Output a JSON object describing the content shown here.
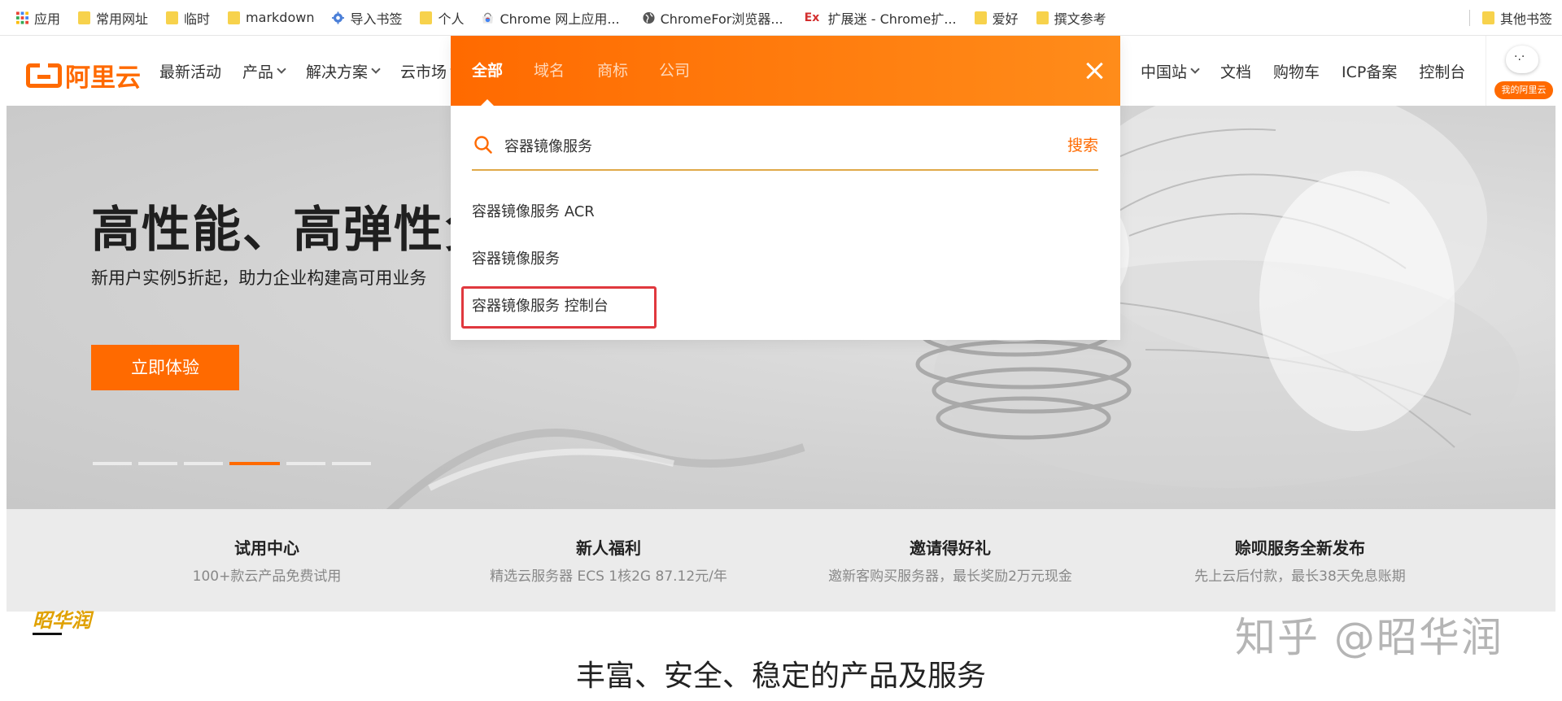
{
  "bookmarks": {
    "items": [
      {
        "label": "应用",
        "icon": "apps-grid-icon"
      },
      {
        "label": "常用网址",
        "icon": "folder-icon"
      },
      {
        "label": "临时",
        "icon": "folder-icon"
      },
      {
        "label": "markdown",
        "icon": "folder-icon"
      },
      {
        "label": "导入书签",
        "icon": "gear-icon"
      },
      {
        "label": "个人",
        "icon": "folder-icon"
      },
      {
        "label": "Chrome 网上应用...",
        "icon": "chrome-webstore-icon"
      },
      {
        "label": "ChromeFor浏览器...",
        "icon": "globe-icon"
      },
      {
        "label": "扩展迷 - Chrome扩...",
        "icon": "ex-icon"
      },
      {
        "label": "爱好",
        "icon": "folder-icon"
      },
      {
        "label": "撰文参考",
        "icon": "folder-icon"
      }
    ],
    "other": "其他书签",
    "ex_glyph": "Ex"
  },
  "nav": {
    "logo": "阿里云",
    "left": [
      "最新活动",
      "产品",
      "解决方案",
      "云市场"
    ],
    "right": [
      "中国站",
      "文档",
      "购物车",
      "ICP备案",
      "控制台"
    ],
    "avatar_badge": "我的阿里云"
  },
  "search_panel": {
    "tabs": [
      "全部",
      "域名",
      "商标",
      "公司"
    ],
    "active_tab": "全部",
    "query": "容器镜像服务",
    "search_button": "搜索",
    "suggestions": [
      "容器镜像服务 ACR",
      "容器镜像服务",
      "容器镜像服务 控制台"
    ],
    "highlight_color": "#e0383e"
  },
  "hero": {
    "title": "高性能、高弹性负",
    "subtitle": "新用户实例5折起，助力企业构建高可用业务",
    "cta": "立即体验",
    "slides": 6,
    "active_slide": 4
  },
  "features": [
    {
      "title": "试用中心",
      "desc": "100+款云产品免费试用"
    },
    {
      "title": "新人福利",
      "desc": "精选云服务器 ECS 1核2G 87.12元/年"
    },
    {
      "title": "邀请得好礼",
      "desc": "邀新客购买服务器，最长奖励2万元现金"
    },
    {
      "title": "赊呗服务全新发布",
      "desc": "先上云后付款，最长38天免息账期"
    }
  ],
  "section_title": "丰富、安全、稳定的产品及服务",
  "watermark": {
    "text": "知乎 @昭华润",
    "logo_text": "昭华润"
  },
  "colors": {
    "brand": "#ff6a00",
    "brand_light": "#ff8c1a"
  }
}
